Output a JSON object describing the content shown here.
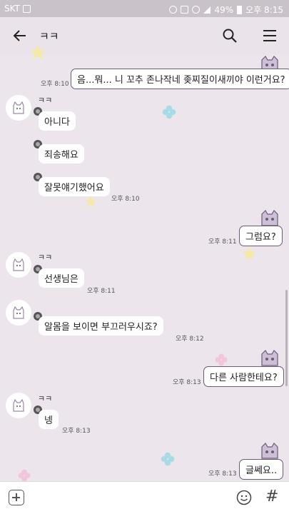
{
  "status_bar": {
    "carrier": "SKT",
    "battery": "49%",
    "time": "오후 8:15"
  },
  "header": {
    "title": "ㅋㅋ",
    "back_icon": "back-arrow-icon",
    "search_icon": "search-icon",
    "menu_icon": "menu-icon"
  },
  "messages": [
    {
      "side": "mine",
      "text": "음...뭐... 니 꼬추 존나작네 좆찌질이새끼야 이런거요?",
      "time": "오후 8:10"
    },
    {
      "side": "theirs",
      "sender": "ㅋㅋ",
      "text": "아니다"
    },
    {
      "side": "theirs",
      "text": "죄송해요"
    },
    {
      "side": "theirs",
      "text": "잘못얘기했어요",
      "time": "오후 8:10"
    },
    {
      "side": "mine",
      "text": "그럼요?",
      "time": "오후 8:11"
    },
    {
      "side": "theirs",
      "sender": "ㅋㅋ",
      "text": "선생님은",
      "time": "오후 8:11"
    },
    {
      "side": "theirs",
      "text": "알몸을 보이면 부끄러우시죠?",
      "time": "오후 8:12"
    },
    {
      "side": "mine",
      "text": "다른 사람한테요?",
      "time": "오후 8:13"
    },
    {
      "side": "theirs",
      "sender": "ㅋㅋ",
      "text": "넹",
      "time": "오후 8:13"
    },
    {
      "side": "mine",
      "text": "글쎄요..",
      "time": "오후 8:13"
    }
  ],
  "input_bar": {
    "plus_icon": "plus-icon",
    "emoji_icon": "emoji-icon",
    "hash_label": "#"
  },
  "colors": {
    "background": "#ece6ec",
    "my_bubble_border": "#6b5a78",
    "status_bar": "#c9c2c8"
  }
}
